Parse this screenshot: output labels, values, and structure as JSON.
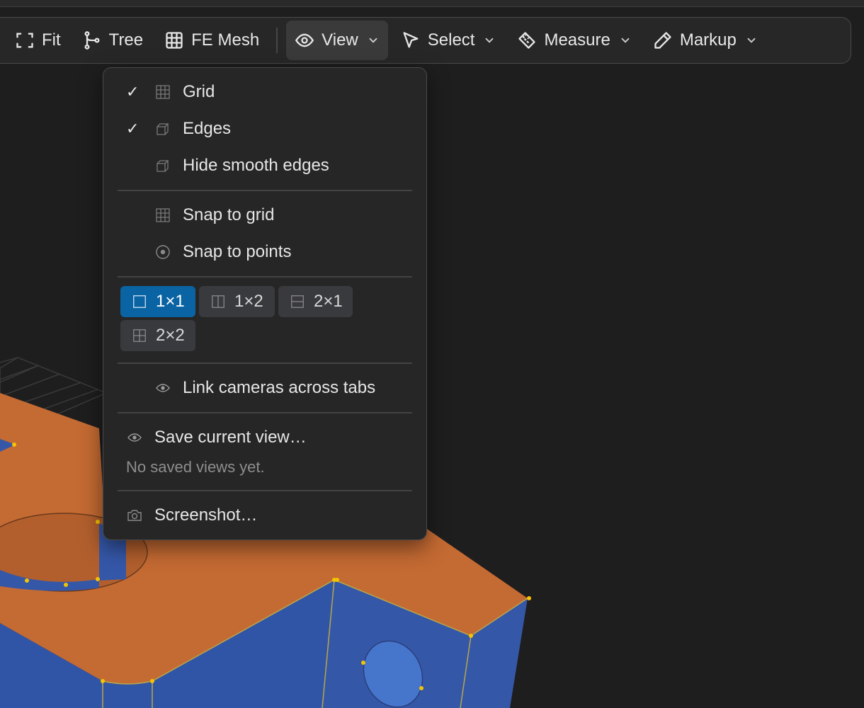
{
  "toolbar": {
    "fit": "Fit",
    "tree": "Tree",
    "fe_mesh": "FE Mesh",
    "view": "View",
    "select": "Select",
    "measure": "Measure",
    "markup": "Markup"
  },
  "view_menu": {
    "grid": "Grid",
    "edges": "Edges",
    "hide_smooth_edges": "Hide smooth edges",
    "snap_to_grid": "Snap to grid",
    "snap_to_points": "Snap to points",
    "check_mark": "✓",
    "layouts": [
      "1×1",
      "1×2",
      "2×1",
      "2×2"
    ],
    "selected_layout": "1×1",
    "link_cameras": "Link cameras across tabs",
    "save_view": "Save current view…",
    "no_saved_views": "No saved views yet.",
    "screenshot": "Screenshot…"
  },
  "colors": {
    "accent": "#0a64a3",
    "model_top": "#c46a33",
    "model_side": "#3557a8",
    "vertex": "#f5c400"
  }
}
